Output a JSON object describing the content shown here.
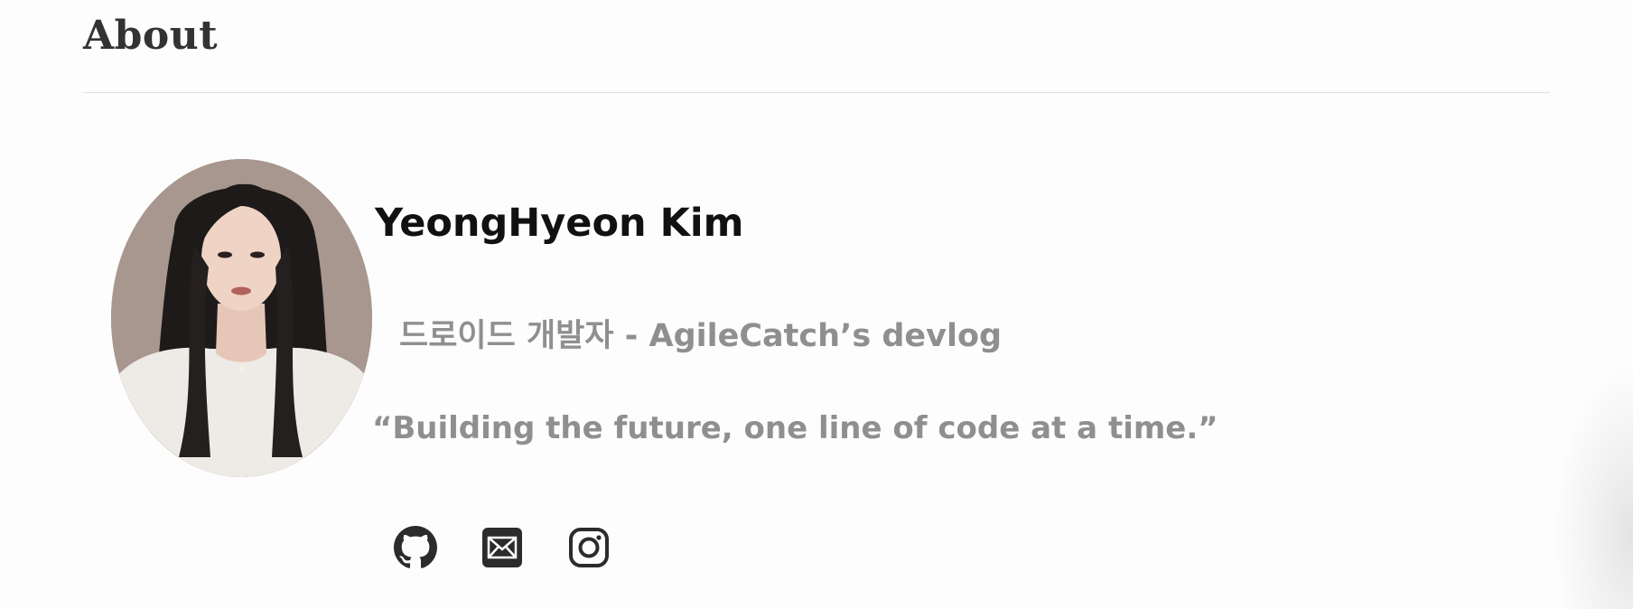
{
  "header": {
    "title": "About"
  },
  "profile": {
    "name": "YeongHyeon Kim",
    "role": "드로이드 개발자 - AgileCatch’s devlog",
    "quote": "“Building the future, one line of code at a time.”",
    "avatar_alt": "Profile photo of YeongHyeon Kim"
  },
  "social_links": [
    {
      "name": "GitHub",
      "icon": "github-icon"
    },
    {
      "name": "Email",
      "icon": "mail-icon"
    },
    {
      "name": "Instagram",
      "icon": "instagram-icon"
    }
  ],
  "colors": {
    "background": "#fdfdfd",
    "title": "#333333",
    "name": "#111111",
    "muted_text": "#8f8f8f",
    "divider": "#e2e2e2",
    "icon": "#2b2b2b",
    "avatar_bg": "#a7978e"
  }
}
